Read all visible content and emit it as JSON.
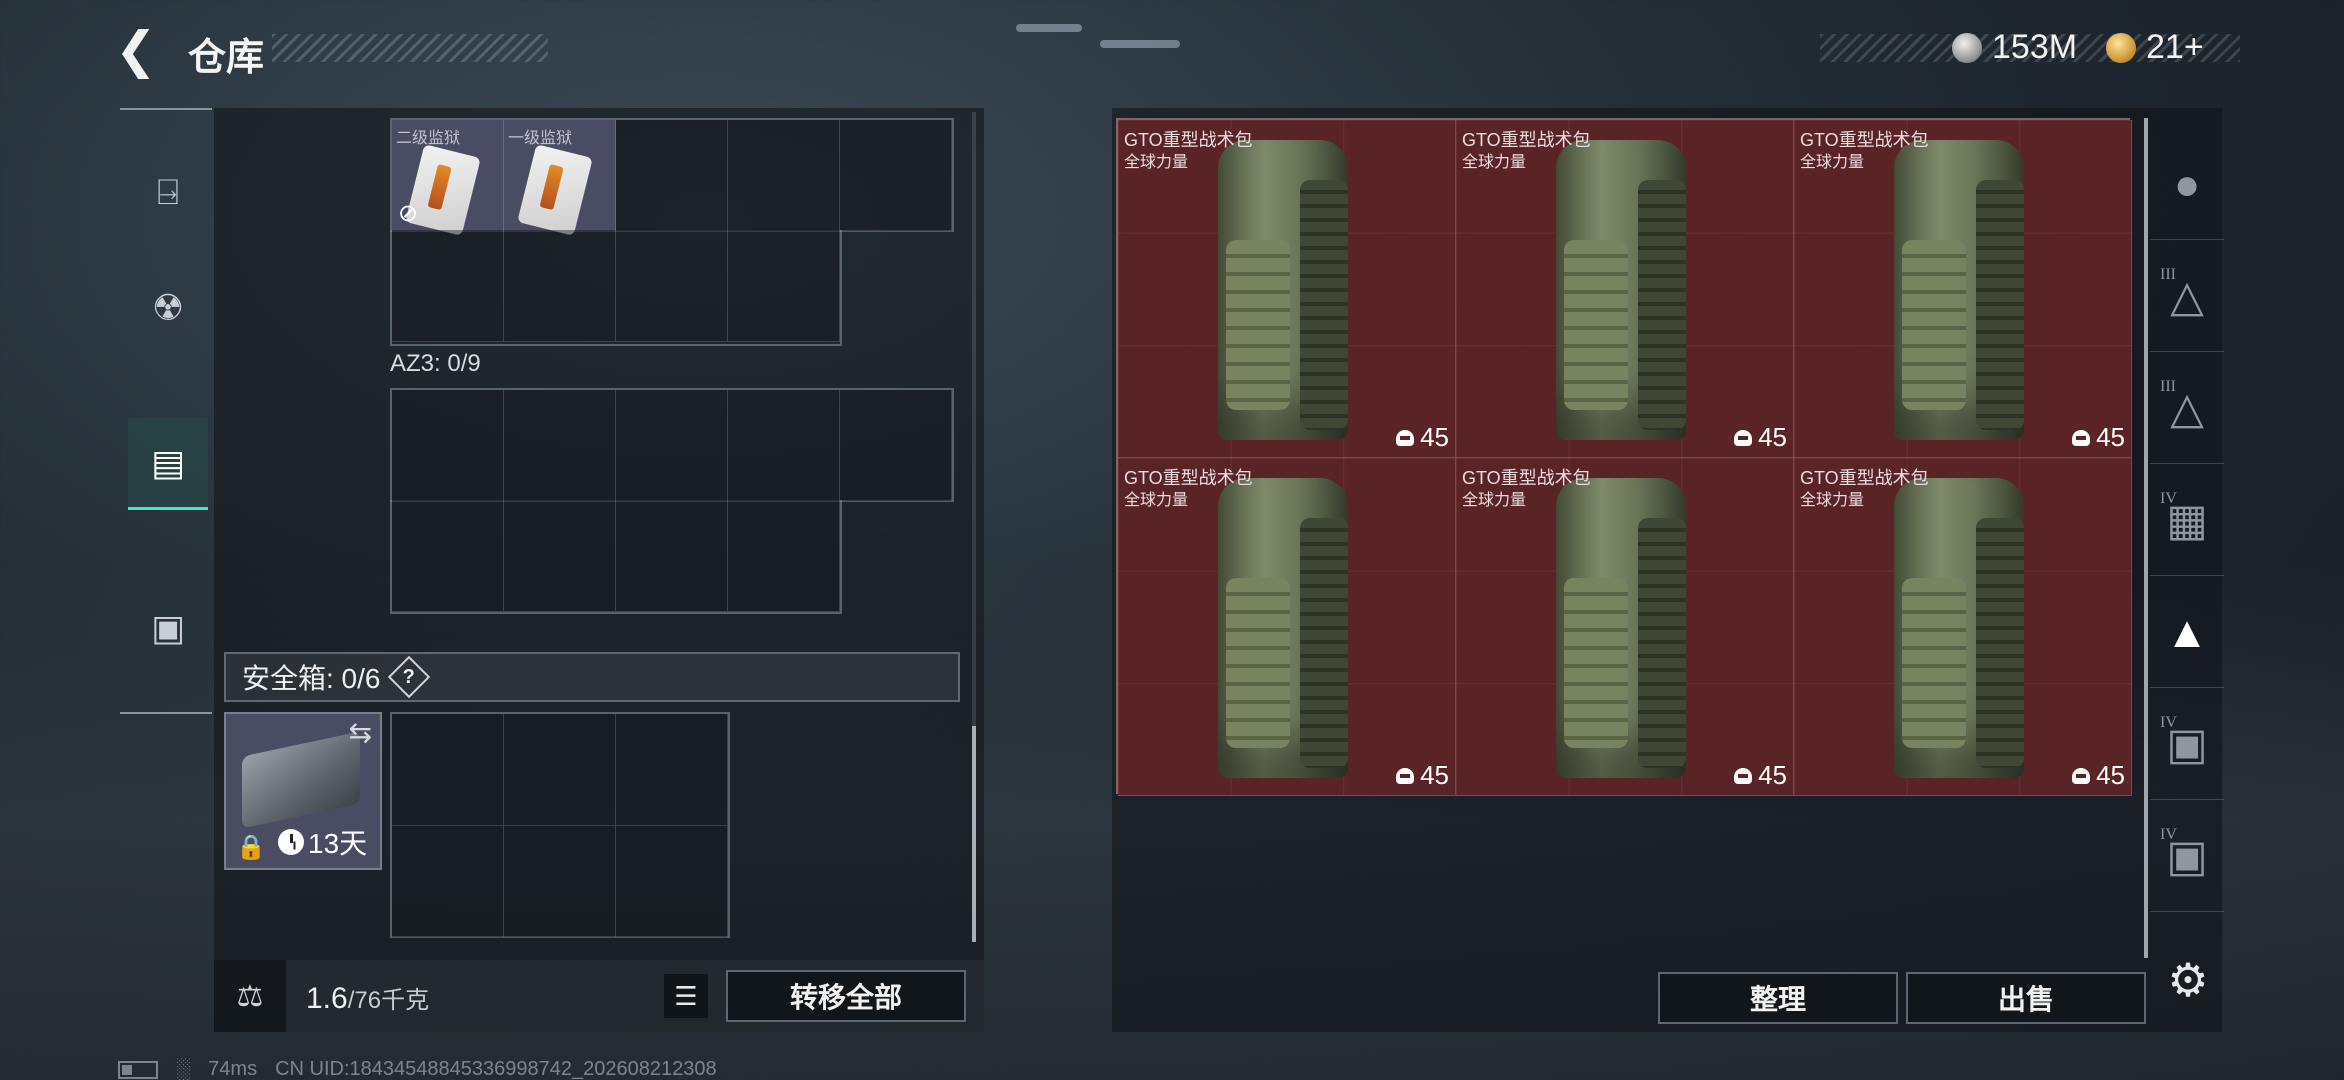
{
  "header": {
    "back_icon": "chevron-left-icon",
    "title": "仓库",
    "currency_silver": "153M",
    "currency_gold": "21+"
  },
  "left_tabs": [
    {
      "icon": "pistol-icon",
      "active": false
    },
    {
      "icon": "vest-icon",
      "active": false
    },
    {
      "icon": "backpack-icon",
      "active": true
    },
    {
      "icon": "briefcase-icon",
      "active": false
    }
  ],
  "container": {
    "items": [
      {
        "name": "二级监狱",
        "icon": "keycard-icon",
        "disabled_icon": "no-transfer-icon"
      },
      {
        "name": "一级监狱",
        "icon": "keycard-icon"
      }
    ],
    "az3_label": "AZ3: 0/9"
  },
  "safe": {
    "label": "安全箱: 0/6",
    "help_icon": "?",
    "duration": "13天"
  },
  "bottom": {
    "weight_value": "1.6",
    "weight_capacity": "/76千克",
    "transfer_all": "转移全部"
  },
  "stash": {
    "items": [
      {
        "name": "GTO重型战术包",
        "brand": "全球力量",
        "count": "45"
      },
      {
        "name": "GTO重型战术包",
        "brand": "全球力量",
        "count": "45"
      },
      {
        "name": "GTO重型战术包",
        "brand": "全球力量",
        "count": "45"
      },
      {
        "name": "GTO重型战术包",
        "brand": "全球力量",
        "count": "45"
      },
      {
        "name": "GTO重型战术包",
        "brand": "全球力量",
        "count": "45"
      },
      {
        "name": "GTO重型战术包",
        "brand": "全球力量",
        "count": "45"
      }
    ],
    "organize": "整理",
    "sell": "出售"
  },
  "right_tabs": [
    {
      "icon": "helmet-icon",
      "tier": ""
    },
    {
      "icon": "armor-tier-icon",
      "tier": "III"
    },
    {
      "icon": "armor-tier-icon",
      "tier": "III"
    },
    {
      "icon": "rig-tier-icon",
      "tier": "IV"
    },
    {
      "icon": "armor-icon",
      "tier": ""
    },
    {
      "icon": "backpack-tier-icon",
      "tier": "IV"
    },
    {
      "icon": "backpack-tier-icon",
      "tier": "IV"
    }
  ],
  "footer": {
    "ping": "74ms",
    "uid": "CN UID:18434548845336998742_202608212308"
  }
}
